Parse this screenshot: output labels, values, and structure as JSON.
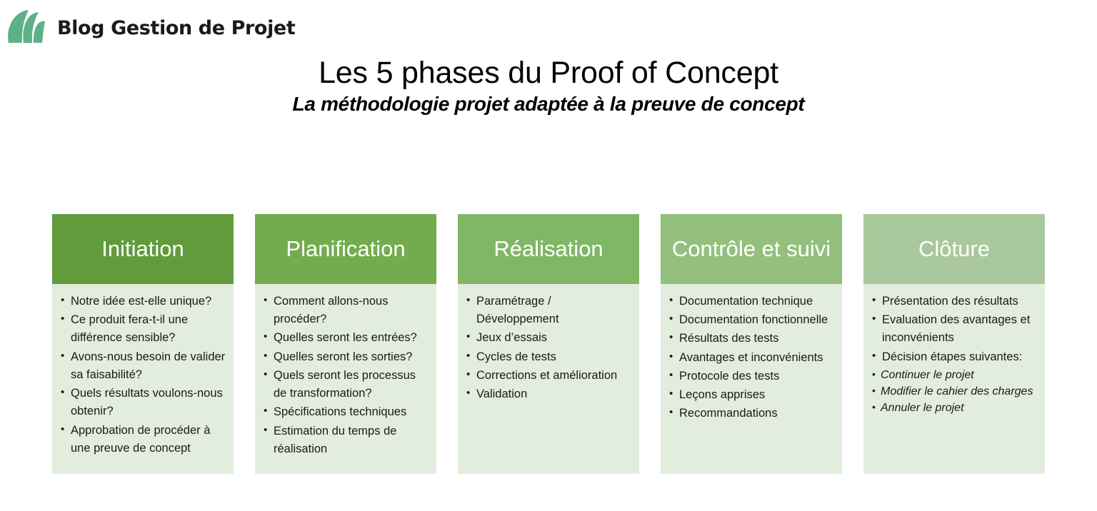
{
  "brand": {
    "name": "Blog Gestion de Projet",
    "logo_icon": "leaf-logo-icon",
    "logo_color": "#5cb286"
  },
  "header": {
    "title": "Les 5 phases du Proof of Concept",
    "subtitle": "La méthodologie projet adaptée à la preuve de concept"
  },
  "colors": {
    "header_1": "#629b3c",
    "header_2": "#72ac4f",
    "header_3": "#80b766",
    "header_4": "#93c07d",
    "header_5": "#a9c89b",
    "body_bg": "#e2edde",
    "title_text": "#ffffff",
    "bullet_text": "#1a1a1a"
  },
  "phases": [
    {
      "title": "Initiation",
      "header_color": "#629b3c",
      "bullets": [
        "Notre idée est-elle unique?",
        "Ce produit fera-t-il une différence sensible?",
        "Avons-nous besoin de valider sa faisabilité?",
        "Quels résultats voulons-nous obtenir?",
        "Approbation de procéder à une preuve de concept"
      ],
      "subbullets": []
    },
    {
      "title": "Planification",
      "header_color": "#72ac4f",
      "bullets": [
        "Comment allons-nous procéder?",
        "Quelles seront les entrées?",
        "Quelles seront les sorties?",
        "Quels seront les processus de transformation?",
        "Spécifications techniques",
        "Estimation du temps de réalisation"
      ],
      "subbullets": []
    },
    {
      "title": "Réalisation",
      "header_color": "#80b766",
      "bullets": [
        "Paramétrage / Développement",
        "Jeux d’essais",
        "Cycles de tests",
        "Corrections et amélioration",
        "Validation"
      ],
      "subbullets": []
    },
    {
      "title": "Contrôle et suivi",
      "header_color": "#93c07d",
      "bullets": [
        "Documentation technique",
        "Documentation fonctionnelle",
        "Résultats des tests",
        "Avantages et inconvénients",
        "Protocole des tests",
        "Leçons apprises",
        "Recommandations"
      ],
      "subbullets": []
    },
    {
      "title": "Clôture",
      "header_color": "#a9c89b",
      "bullets": [
        "Présentation des résultats",
        "Evaluation des avantages et inconvénients",
        "Décision étapes suivantes:"
      ],
      "subbullets": [
        "Continuer le projet",
        "Modifier le cahier des charges",
        "Annuler le projet"
      ]
    }
  ]
}
